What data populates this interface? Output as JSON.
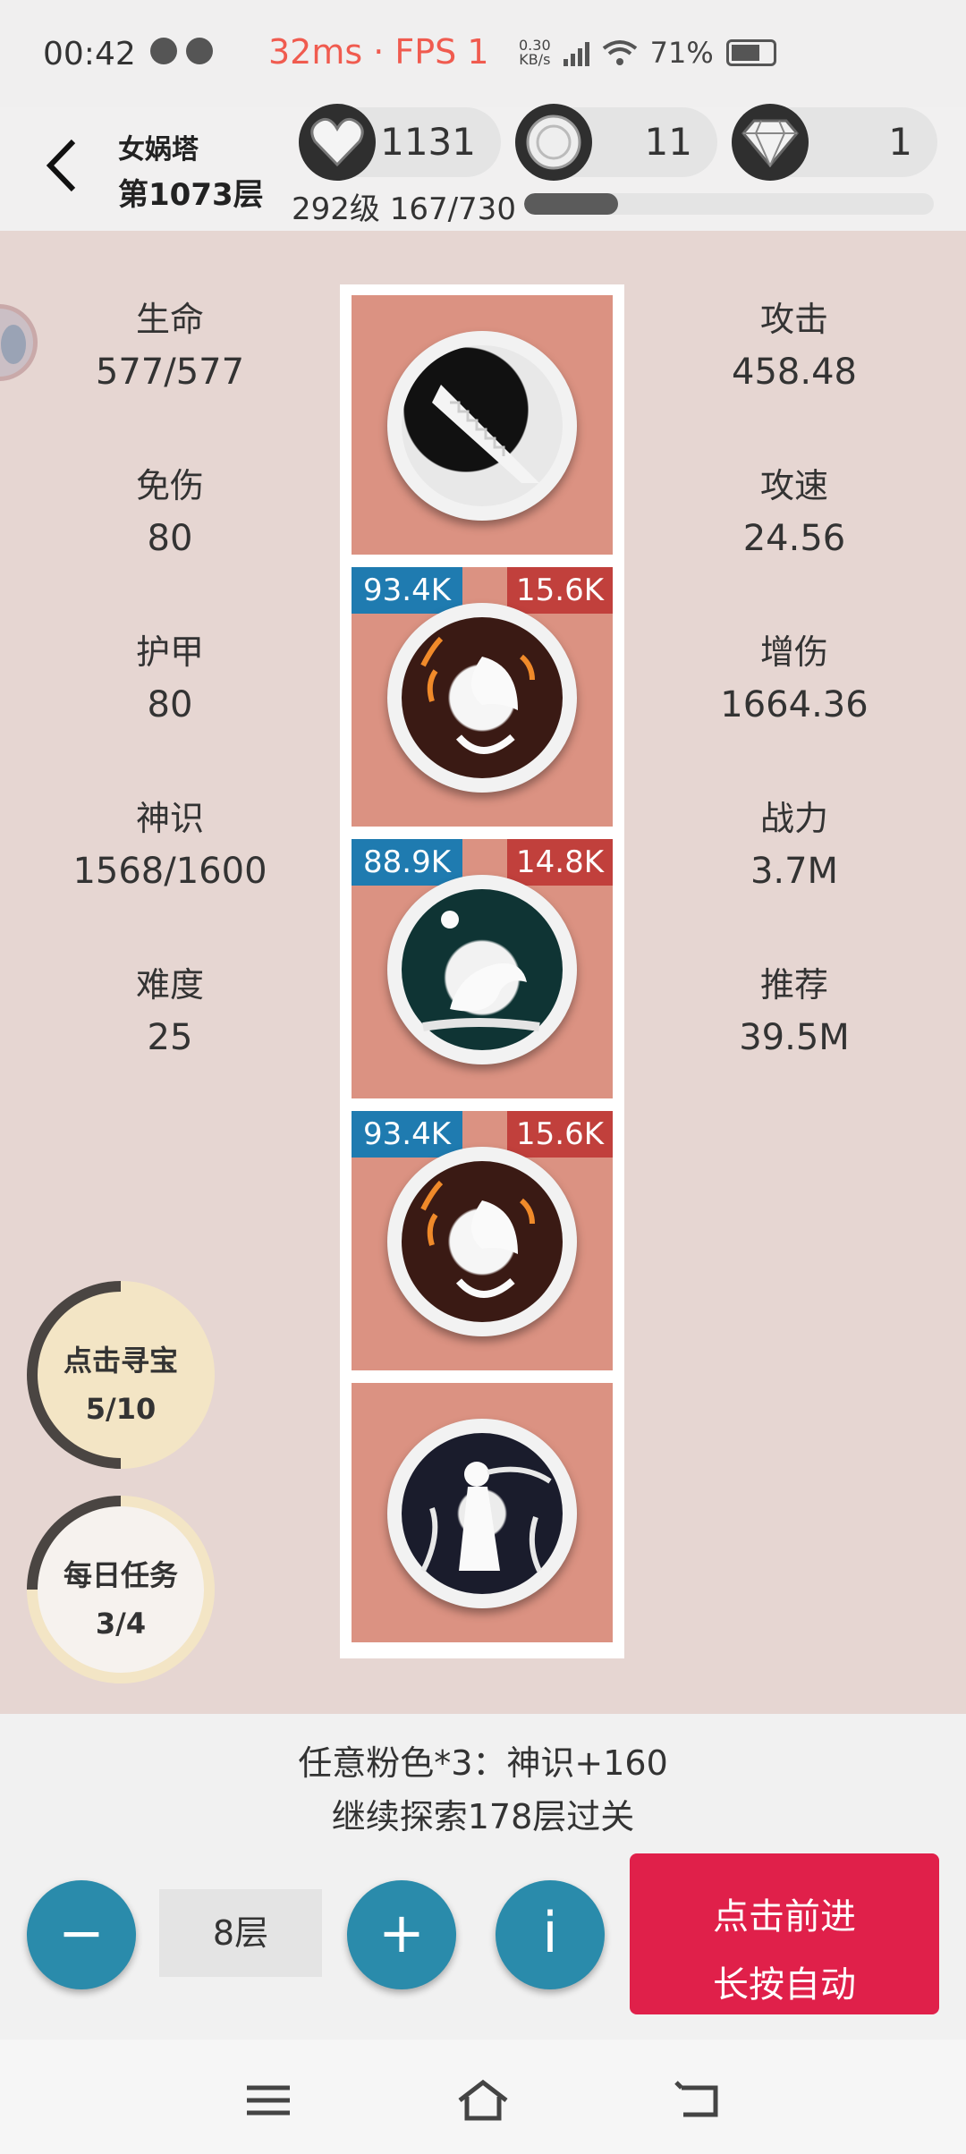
{
  "status_bar": {
    "time": "00:42",
    "perf": "32ms · FPS 1",
    "net_speed_top": "0.30",
    "net_speed_bottom": "KB/s",
    "battery": "71%",
    "battery_level": 0.71
  },
  "header": {
    "tower_name": "女娲塔",
    "floor": "第1073层",
    "resources": [
      {
        "icon": "heart-icon",
        "value": "1131"
      },
      {
        "icon": "coin-icon",
        "value": "11"
      },
      {
        "icon": "diamond-icon",
        "value": "1"
      }
    ],
    "level_text": "292级 167/730",
    "xp_fraction": 0.229
  },
  "stats_left": [
    {
      "label": "生命",
      "value": "577/577"
    },
    {
      "label": "免伤",
      "value": "80"
    },
    {
      "label": "护甲",
      "value": "80"
    },
    {
      "label": "神识",
      "value": "1568/1600"
    },
    {
      "label": "难度",
      "value": "25"
    }
  ],
  "stats_right": [
    {
      "label": "攻击",
      "value": "458.48"
    },
    {
      "label": "攻速",
      "value": "24.56"
    },
    {
      "label": "增伤",
      "value": "1664.36"
    },
    {
      "label": "战力",
      "value": "3.7M"
    },
    {
      "label": "推荐",
      "value": "39.5M"
    }
  ],
  "tower_cells": [
    {
      "icon": "staircase-icon",
      "hp": "",
      "atk": ""
    },
    {
      "icon": "phoenix-icon",
      "hp": "93.4K",
      "atk": "15.6K"
    },
    {
      "icon": "dragon-icon",
      "hp": "88.9K",
      "atk": "14.8K"
    },
    {
      "icon": "phoenix-icon",
      "hp": "93.4K",
      "atk": "15.6K"
    },
    {
      "icon": "goddess-icon",
      "hp": "",
      "atk": ""
    }
  ],
  "treasure": {
    "label": "点击寻宝",
    "progress": "5/10",
    "fraction": 0.5
  },
  "daily": {
    "label": "每日任务",
    "progress": "3/4",
    "fraction": 0.75
  },
  "bottom": {
    "reward_text": "任意粉色*3：神识+160",
    "goal_text": "继续探索178层过关",
    "minus_label": "−",
    "floors_value": "8层",
    "plus_label": "+",
    "info_label": "i",
    "go_line1": "点击前进",
    "go_line2": "长按自动"
  },
  "colors": {
    "accent_red": "#e0204a",
    "button_teal": "#2a8bab",
    "cell_salmon": "#db9282",
    "hp_blue": "#1f7bb0",
    "atk_red": "#c1403c"
  }
}
